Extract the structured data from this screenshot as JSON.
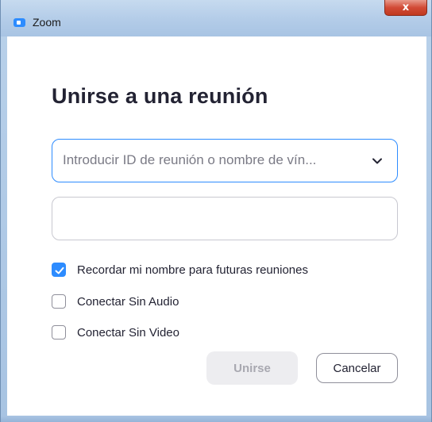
{
  "window": {
    "title": "Zoom",
    "close_glyph": "x",
    "accent_color": "#2d8cff"
  },
  "dialog": {
    "heading": "Unirse a una reunión",
    "meeting_combo": {
      "placeholder": "Introducir ID de reunión o nombre de vín...",
      "icon": "chevron-down-icon"
    },
    "name_input": {
      "value": ""
    },
    "options": [
      {
        "label": "Recordar mi nombre para futuras reuniones",
        "checked": true
      },
      {
        "label": "Conectar Sin Audio",
        "checked": false
      },
      {
        "label": "Conectar Sin Video",
        "checked": false
      }
    ],
    "buttons": {
      "join": "Unirse",
      "cancel": "Cancelar"
    }
  }
}
